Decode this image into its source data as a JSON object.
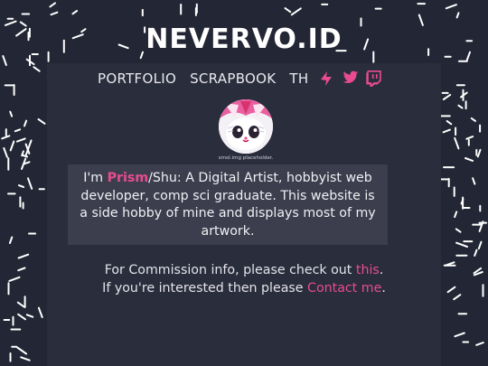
{
  "site": {
    "title": "NEVERVO.ID"
  },
  "nav": {
    "links": [
      "PORTFOLIO",
      "SCRAPBOOK",
      "TH"
    ],
    "icons": [
      "art-app-icon",
      "twitter-icon",
      "twitch-icon"
    ],
    "accent": "#e84c8e"
  },
  "avatar": {
    "caption": "smol.img placeholder."
  },
  "bio": {
    "pre": "I'm ",
    "name": "Prism",
    "post": "/Shu: A Digital Artist, hobbyist web developer, comp sci graduate. This website is a side hobby of mine and displays most of my artwork."
  },
  "commission": {
    "line1_pre": "For Commission info, please check out ",
    "line1_link": "this",
    "line1_post": ".",
    "line2_pre": "If you're interested then please ",
    "line2_link": "Contact me",
    "line2_post": "."
  },
  "colors": {
    "background": "#232634",
    "panel": "#2a2d3c",
    "bio_box": "#3c3e4e",
    "accent": "#e84c8e"
  }
}
